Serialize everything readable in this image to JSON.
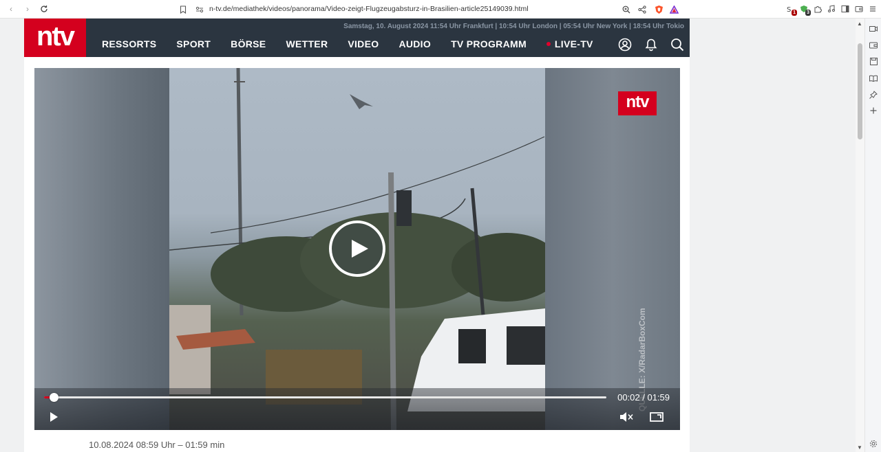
{
  "browser": {
    "url": "n-tv.de/mediathek/videos/panorama/Video-zeigt-Flugzeugabsturz-in-Brasilien-article25149039.html",
    "extensions": [
      {
        "name": "script-blocker-icon",
        "badge": "1"
      },
      {
        "name": "shield-icon",
        "badge": "3"
      }
    ]
  },
  "header": {
    "logo": "ntv",
    "date_line": "Samstag, 10. August 2024 11:54 Uhr Frankfurt | 10:54 Uhr London | 05:54 Uhr New York | 18:54 Uhr Tokio",
    "nav": [
      {
        "label": "RESSORTS",
        "live": false
      },
      {
        "label": "SPORT",
        "live": false
      },
      {
        "label": "BÖRSE",
        "live": false
      },
      {
        "label": "WETTER",
        "live": false
      },
      {
        "label": "VIDEO",
        "live": false
      },
      {
        "label": "AUDIO",
        "live": false
      },
      {
        "label": "TV PROGRAMM",
        "live": false
      },
      {
        "label": "LIVE-TV",
        "live": true
      }
    ],
    "colors": {
      "brand_red": "#d4001e",
      "header_bg": "#2b3540"
    }
  },
  "video": {
    "watermark": "ntv",
    "source_credit": "QUELLE: X/RadarBoxCom",
    "current_time": "00:02",
    "duration": "01:59",
    "time_display": "00:02 / 01:59",
    "progress_fraction": 0.017
  },
  "article": {
    "meta": "10.08.2024 08:59 Uhr – 01:59 min"
  }
}
